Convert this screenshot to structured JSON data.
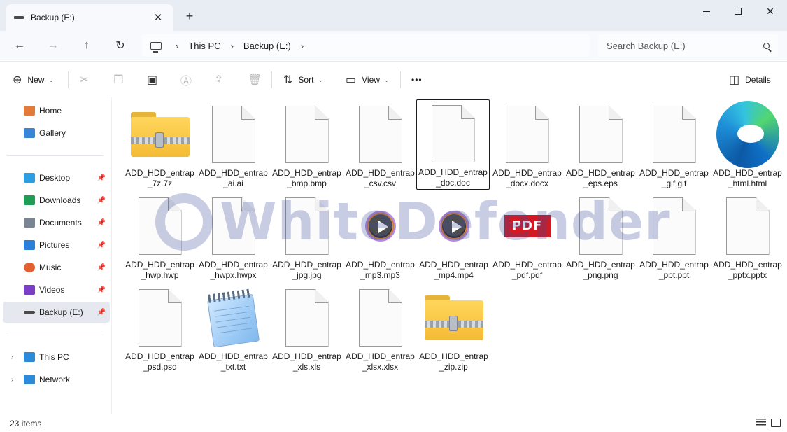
{
  "window": {
    "tab_title": "Backup (E:)",
    "tab_close": "✕",
    "new_tab": "+",
    "minimize": "",
    "maximize": "",
    "close": "✕"
  },
  "nav": {
    "back": "←",
    "forward": "→",
    "up": "↑",
    "refresh": "↻",
    "breadcrumbs": [
      "This PC",
      "Backup (E:)"
    ],
    "search_placeholder": "Search Backup (E:)"
  },
  "toolbar": {
    "new_label": "New",
    "sort_label": "Sort",
    "view_label": "View",
    "more_label": "•••",
    "details_label": "Details"
  },
  "sidebar": {
    "items": [
      {
        "label": "Home",
        "color": "#e07b39"
      },
      {
        "label": "Gallery",
        "color": "#3a86d6"
      },
      {
        "label": "Desktop",
        "color": "#2f9ee0"
      },
      {
        "label": "Downloads",
        "color": "#1f9d55"
      },
      {
        "label": "Documents",
        "color": "#7a8594"
      },
      {
        "label": "Pictures",
        "color": "#2b7fd9"
      },
      {
        "label": "Music",
        "color": "#e2602f"
      },
      {
        "label": "Videos",
        "color": "#7a3fc2"
      },
      {
        "label": "Backup (E:)",
        "color": "#4a4a4a"
      },
      {
        "label": "This PC",
        "color": "#2c8ad8"
      },
      {
        "label": "Network",
        "color": "#2c8ad8"
      }
    ]
  },
  "files": [
    {
      "name": "ADD_HDD_entrap_7z.7z",
      "icon": "zip-folder-icon"
    },
    {
      "name": "ADD_HDD_entrap_ai.ai",
      "icon": "blank-file-icon"
    },
    {
      "name": "ADD_HDD_entrap_bmp.bmp",
      "icon": "blank-file-icon"
    },
    {
      "name": "ADD_HDD_entrap_csv.csv",
      "icon": "blank-file-icon"
    },
    {
      "name": "ADD_HDD_entrap_doc.doc",
      "icon": "blank-file-icon"
    },
    {
      "name": "ADD_HDD_entrap_docx.docx",
      "icon": "blank-file-icon"
    },
    {
      "name": "ADD_HDD_entrap_eps.eps",
      "icon": "blank-file-icon"
    },
    {
      "name": "ADD_HDD_entrap_gif.gif",
      "icon": "blank-file-icon"
    },
    {
      "name": "ADD_HDD_entrap_html.html",
      "icon": "edge-browser-icon"
    },
    {
      "name": "ADD_HDD_entrap_hwp.hwp",
      "icon": "blank-file-icon"
    },
    {
      "name": "ADD_HDD_entrap_hwpx.hwpx",
      "icon": "blank-file-icon"
    },
    {
      "name": "ADD_HDD_entrap_jpg.jpg",
      "icon": "blank-file-icon"
    },
    {
      "name": "ADD_HDD_entrap_mp3.mp3",
      "icon": "media-play-icon"
    },
    {
      "name": "ADD_HDD_entrap_mp4.mp4",
      "icon": "media-play-icon"
    },
    {
      "name": "ADD_HDD_entrap_pdf.pdf",
      "icon": "pdf-icon",
      "badge": "PDF"
    },
    {
      "name": "ADD_HDD_entrap_png.png",
      "icon": "blank-file-icon"
    },
    {
      "name": "ADD_HDD_entrap_ppt.ppt",
      "icon": "blank-file-icon"
    },
    {
      "name": "ADD_HDD_entrap_pptx.pptx",
      "icon": "blank-file-icon"
    },
    {
      "name": "ADD_HDD_entrap_psd.psd",
      "icon": "blank-file-icon"
    },
    {
      "name": "ADD_HDD_entrap_txt.txt",
      "icon": "notepad-icon"
    },
    {
      "name": "ADD_HDD_entrap_xls.xls",
      "icon": "blank-file-icon"
    },
    {
      "name": "ADD_HDD_entrap_xlsx.xlsx",
      "icon": "blank-file-icon"
    },
    {
      "name": "ADD_HDD_entrap_zip.zip",
      "icon": "zip-folder-icon"
    }
  ],
  "watermark": {
    "text": "WhiteDefender"
  },
  "status": {
    "item_count": "23 items"
  },
  "colors": {
    "accent": "#0067c0",
    "watermark": "#3f4f9c",
    "pdf_red": "#d11a24"
  }
}
